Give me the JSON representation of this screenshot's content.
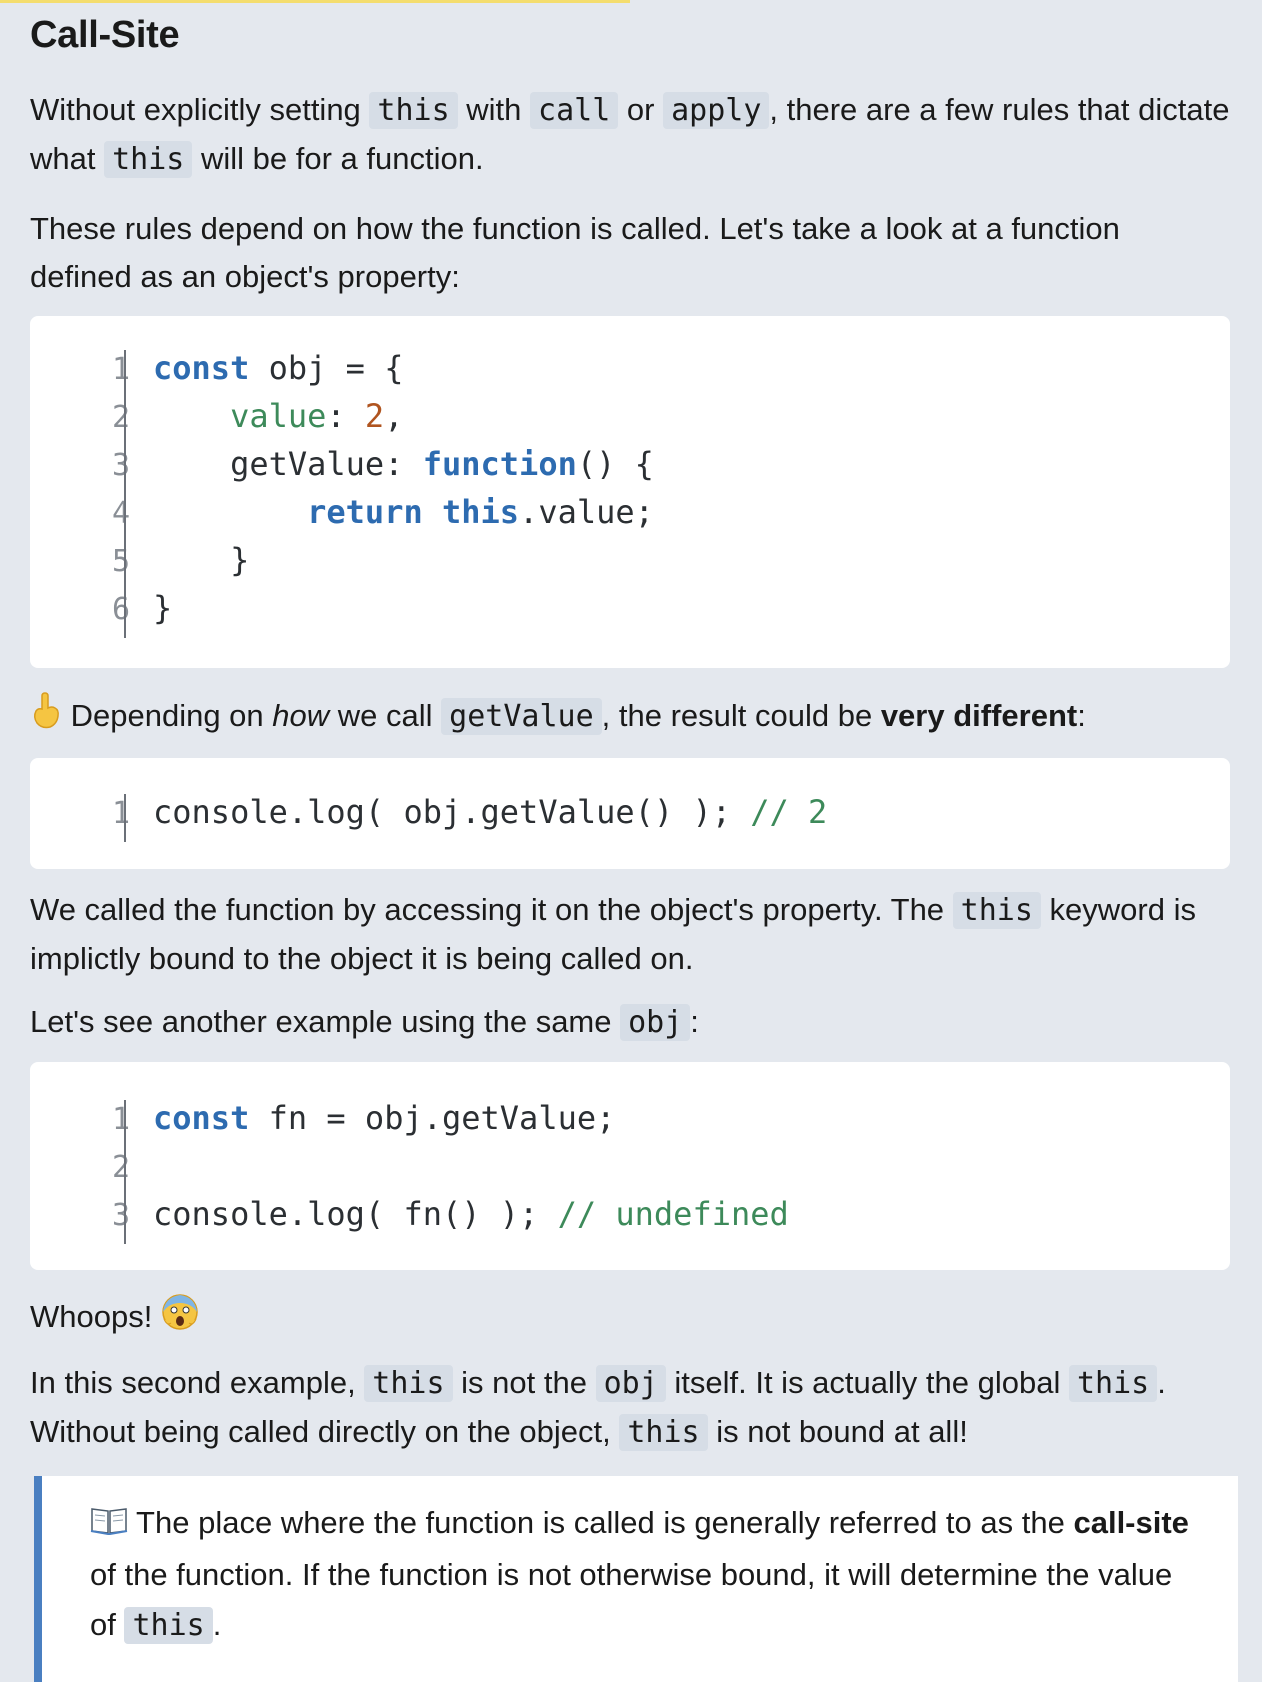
{
  "heading": "Call-Site",
  "p1": {
    "a": "Without explicitly setting ",
    "c1": "this",
    "b": " with ",
    "c2": "call",
    "c": " or ",
    "c3": "apply",
    "d": ", there are a few rules that dictate what ",
    "c4": "this",
    "e": " will be for a function."
  },
  "p2": "These rules depend on how the function is called. Let's take a look at a function defined as an object's property:",
  "code1": {
    "numbers": [
      "1",
      "2",
      "3",
      "4",
      "5",
      "6"
    ],
    "lines": [
      [
        {
          "t": "const",
          "c": "kw"
        },
        {
          "t": " obj = {",
          "c": ""
        }
      ],
      [
        {
          "t": "    ",
          "c": ""
        },
        {
          "t": "value",
          "c": "prop"
        },
        {
          "t": ": ",
          "c": ""
        },
        {
          "t": "2",
          "c": "num"
        },
        {
          "t": ",",
          "c": ""
        }
      ],
      [
        {
          "t": "    getValue: ",
          "c": ""
        },
        {
          "t": "function",
          "c": "kw"
        },
        {
          "t": "() {",
          "c": ""
        }
      ],
      [
        {
          "t": "        ",
          "c": ""
        },
        {
          "t": "return",
          "c": "kw"
        },
        {
          "t": " ",
          "c": ""
        },
        {
          "t": "this",
          "c": "kw"
        },
        {
          "t": ".value;",
          "c": ""
        }
      ],
      [
        {
          "t": "    }",
          "c": ""
        }
      ],
      [
        {
          "t": "}",
          "c": ""
        }
      ]
    ]
  },
  "p3": {
    "a": " Depending on ",
    "em": "how",
    "b": " we call ",
    "c1": "getValue",
    "c": ", the result could be ",
    "strong": "very different",
    "d": ":"
  },
  "code2": {
    "numbers": [
      "1"
    ],
    "lines": [
      [
        {
          "t": "console.log( obj.getValue() ); ",
          "c": ""
        },
        {
          "t": "// 2",
          "c": "cm"
        }
      ]
    ]
  },
  "p4": {
    "a": "We called the function by accessing it on the object's property. The ",
    "c1": "this",
    "b": " keyword is implictly bound to the object it is being called on."
  },
  "p5": {
    "a": "Let's see another example using the same ",
    "c1": "obj",
    "b": ":"
  },
  "code3": {
    "numbers": [
      "1",
      "2",
      "3"
    ],
    "lines": [
      [
        {
          "t": "const",
          "c": "kw"
        },
        {
          "t": " fn = obj.getValue;",
          "c": ""
        }
      ],
      [
        {
          "t": "",
          "c": ""
        }
      ],
      [
        {
          "t": "console.log( fn() ); ",
          "c": ""
        },
        {
          "t": "// undefined",
          "c": "cm"
        }
      ]
    ]
  },
  "p6": "Whoops! ",
  "p7": {
    "a": "In this second example, ",
    "c1": "this",
    "b": " is not the ",
    "c2": "obj",
    "c": " itself. It is actually the global ",
    "c3": "this",
    "d": ". Without being called directly on the object, ",
    "c4": "this",
    "e": " is not bound at all!"
  },
  "callout": {
    "a": " The place where the function is called is generally referred to as the ",
    "strong": "call-site",
    "b": " of the function. If the function is not otherwise bound, it will determine the value of ",
    "c1": "this",
    "c": "."
  }
}
